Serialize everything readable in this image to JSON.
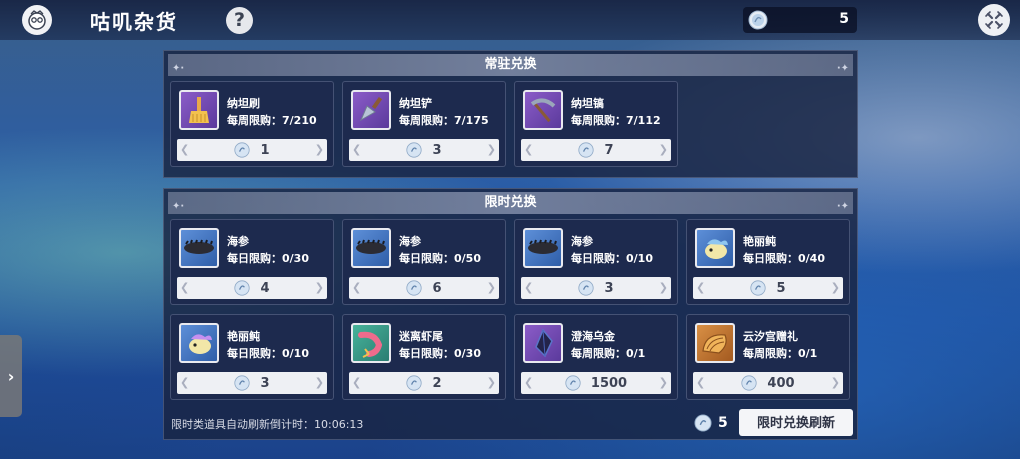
{
  "header": {
    "title": "咕叽杂货",
    "help_label": "?",
    "currency_value": "5"
  },
  "permanent": {
    "title": "常驻兑换",
    "items": [
      {
        "name": "纳坦刷",
        "limit": "每周限购：7/210",
        "price": "1",
        "icon": "broom-icon"
      },
      {
        "name": "纳坦铲",
        "limit": "每周限购：7/175",
        "price": "3",
        "icon": "trowel-icon"
      },
      {
        "name": "纳坦镐",
        "limit": "每周限购：7/112",
        "price": "7",
        "icon": "pickaxe-icon"
      }
    ]
  },
  "limited": {
    "title": "限时兑换",
    "items": [
      {
        "name": "海参",
        "limit": "每日限购：0/30",
        "price": "4",
        "icon": "sea-cucumber-icon"
      },
      {
        "name": "海参",
        "limit": "每日限购：0/50",
        "price": "6",
        "icon": "sea-cucumber-icon"
      },
      {
        "name": "海参",
        "limit": "每日限购：0/10",
        "price": "3",
        "icon": "sea-cucumber-icon"
      },
      {
        "name": "艳丽鲀",
        "limit": "每日限购：0/40",
        "price": "5",
        "icon": "pufferfish-icon"
      },
      {
        "name": "艳丽鲀",
        "limit": "每日限购：0/10",
        "price": "3",
        "icon": "pufferfish-icon"
      },
      {
        "name": "迷离虾尾",
        "limit": "每日限购：0/30",
        "price": "2",
        "icon": "shrimp-tail-icon"
      },
      {
        "name": "澄海乌金",
        "limit": "每周限购：0/1",
        "price": "1500",
        "icon": "dark-crystal-icon"
      },
      {
        "name": "云汐宫赠礼",
        "limit": "每周限购：0/1",
        "price": "400",
        "icon": "shell-gift-icon"
      }
    ]
  },
  "footer": {
    "countdown_text": "限时类道具自动刷新倒计时：10:06:13",
    "refresh_cost": "5",
    "refresh_label": "限时兑换刷新"
  }
}
